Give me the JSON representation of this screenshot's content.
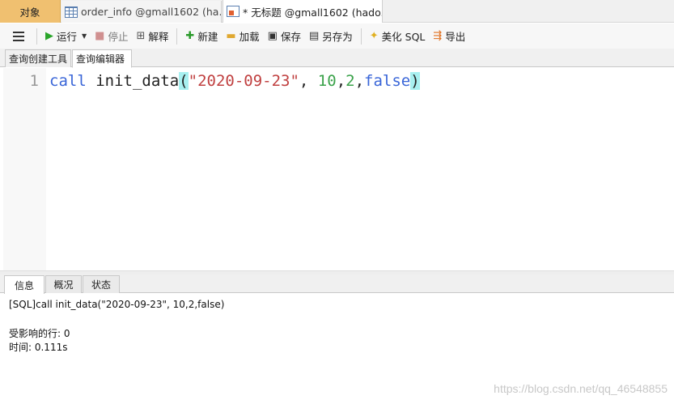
{
  "tabs": {
    "objects": "对象",
    "order_info": "order_info @gmall1602 (ha...",
    "untitled": "* 无标题 @gmall1602 (hado..."
  },
  "toolbar": {
    "run": "运行",
    "stop": "停止",
    "explain": "解释",
    "new": "新建",
    "load": "加载",
    "save": "保存",
    "save_as": "另存为",
    "beautify": "美化 SQL",
    "export": "导出"
  },
  "subtabs": {
    "builder": "查询创建工具",
    "editor": "查询编辑器"
  },
  "editor": {
    "line_number": "1",
    "kw_call": "call",
    "fn_name": "init_data",
    "open_paren": "(",
    "arg_date": "\"2020-09-23\"",
    "comma_space": ", ",
    "arg_num1": "10",
    "comma1": ",",
    "arg_num2": "2",
    "comma2": ",",
    "arg_bool": "false",
    "close_paren": ")"
  },
  "result_tabs": {
    "info": "信息",
    "overview": "概况",
    "status": "状态"
  },
  "output": {
    "sql_line": "[SQL]call init_data(\"2020-09-23\", 10,2,false)",
    "affected_rows": "受影响的行: 0",
    "time": "时间: 0.111s"
  },
  "watermark": "https://blog.csdn.net/qq_46548855",
  "colors": {
    "active_tab": "#f0c070",
    "keyword": "#3a66d8",
    "string": "#c04040",
    "number": "#3aa24a",
    "paren_highlight": "#a8f0f0"
  }
}
